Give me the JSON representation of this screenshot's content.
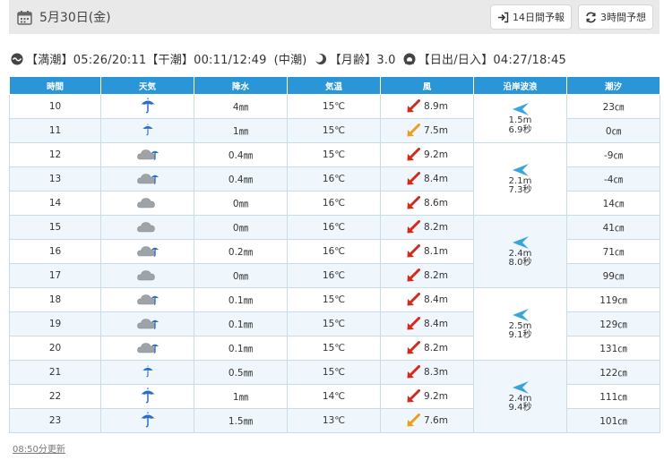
{
  "header": {
    "date": "5月30日(金)",
    "btn_14day": "14日間予報",
    "btn_3hour": "3時間予想"
  },
  "tide_info": {
    "high_tide": "【満潮】05:26/20:11",
    "low_tide": "【干潮】00:11/12:49",
    "tide_type": "(中潮)",
    "moon_age": "【月齢】3.0",
    "sunrise_sunset": "【日出/日入】04:27/18:45"
  },
  "table": {
    "headers": [
      "時間",
      "天気",
      "降水",
      "気温",
      "風",
      "沿岸波浪",
      "潮汐"
    ],
    "rows": [
      {
        "hour": "10",
        "weather": "rain-umbrella",
        "precip": "4㎜",
        "temp": "15℃",
        "wind_dir": "red",
        "wind": "8.9m",
        "tide": "23㎝"
      },
      {
        "hour": "11",
        "weather": "light-rain-umbrella",
        "precip": "1㎜",
        "temp": "15℃",
        "wind_dir": "orange",
        "wind": "7.5m",
        "tide": "0㎝"
      },
      {
        "hour": "12",
        "weather": "cloud-rain",
        "precip": "0.4㎜",
        "temp": "15℃",
        "wind_dir": "red",
        "wind": "9.2m",
        "tide": "-9㎝"
      },
      {
        "hour": "13",
        "weather": "cloud-rain",
        "precip": "0.4㎜",
        "temp": "16℃",
        "wind_dir": "red",
        "wind": "8.4m",
        "tide": "-4㎝"
      },
      {
        "hour": "14",
        "weather": "cloud",
        "precip": "0㎜",
        "temp": "16℃",
        "wind_dir": "red",
        "wind": "8.6m",
        "tide": "14㎝"
      },
      {
        "hour": "15",
        "weather": "cloud",
        "precip": "0㎜",
        "temp": "16℃",
        "wind_dir": "red",
        "wind": "8.2m",
        "tide": "41㎝"
      },
      {
        "hour": "16",
        "weather": "cloud-rain",
        "precip": "0.2㎜",
        "temp": "16℃",
        "wind_dir": "red",
        "wind": "8.1m",
        "tide": "71㎝"
      },
      {
        "hour": "17",
        "weather": "cloud",
        "precip": "0㎜",
        "temp": "16℃",
        "wind_dir": "red",
        "wind": "8.2m",
        "tide": "99㎝"
      },
      {
        "hour": "18",
        "weather": "cloud-rain",
        "precip": "0.1㎜",
        "temp": "15℃",
        "wind_dir": "red",
        "wind": "8.4m",
        "tide": "119㎝"
      },
      {
        "hour": "19",
        "weather": "cloud-rain",
        "precip": "0.1㎜",
        "temp": "15℃",
        "wind_dir": "red",
        "wind": "8.4m",
        "tide": "129㎝"
      },
      {
        "hour": "20",
        "weather": "cloud-rain",
        "precip": "0.1㎜",
        "temp": "15℃",
        "wind_dir": "red",
        "wind": "8.2m",
        "tide": "131㎝"
      },
      {
        "hour": "21",
        "weather": "light-rain-umbrella",
        "precip": "0.5㎜",
        "temp": "15℃",
        "wind_dir": "red",
        "wind": "8.3m",
        "tide": "122㎝"
      },
      {
        "hour": "22",
        "weather": "rain-umbrella",
        "precip": "1㎜",
        "temp": "14℃",
        "wind_dir": "red",
        "wind": "9.2m",
        "tide": "111㎝"
      },
      {
        "hour": "23",
        "weather": "rain-umbrella",
        "precip": "1.5㎜",
        "temp": "13℃",
        "wind_dir": "orange",
        "wind": "7.6m",
        "tide": "101㎝"
      }
    ],
    "waves": [
      {
        "height": "1.5m",
        "period": "6.9秒"
      },
      {
        "height": "2.1m",
        "period": "7.3秒"
      },
      {
        "height": "2.4m",
        "period": "8.0秒"
      },
      {
        "height": "2.5m",
        "period": "9.1秒"
      },
      {
        "height": "2.4m",
        "period": "9.4秒"
      }
    ]
  },
  "footer": {
    "updated": "08:50分更新"
  },
  "colors": {
    "header_blue": "#2a96d8",
    "wind_red": "#d42a1e",
    "wind_orange": "#e8a020",
    "wave_arrow": "#3aa4dc"
  }
}
